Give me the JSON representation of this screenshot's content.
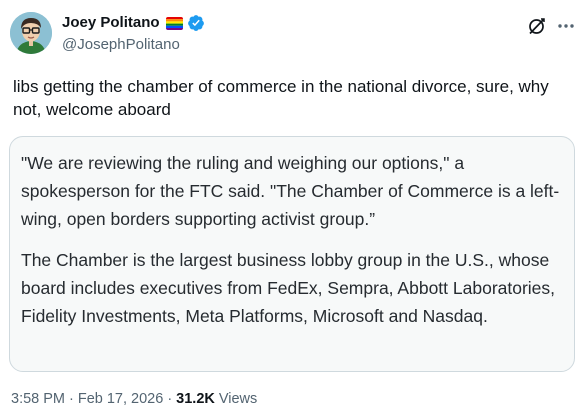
{
  "author": {
    "display_name": "Joey Politano",
    "handle": "@JosephPolitano",
    "flag_emoji": "rainbow-flag",
    "verified": true,
    "verified_color": "#1d9bf0"
  },
  "tweet": {
    "text": "libs getting the chamber of commerce in the national divorce, sure, why not, welcome aboard"
  },
  "quote": {
    "paragraph1": "\"We are reviewing the ruling and weighing our options,\" a spokesperson for the FTC said. \"The Chamber of Commerce is a left-wing, open borders supporting activist group.”",
    "paragraph2": "The Chamber is the largest business lobby group in the U.S., whose board includes executives from FedEx, Sempra, Abbott Laboratories, Fidelity Investments, Meta Platforms, Microsoft and Nasdaq."
  },
  "meta": {
    "time": "3:58 PM",
    "separator": "·",
    "date": "Feb 17, 2026",
    "views_count": "31.2K",
    "views_label": "Views"
  },
  "icons": {
    "grok": "grok-icon",
    "more": "more-icon"
  }
}
